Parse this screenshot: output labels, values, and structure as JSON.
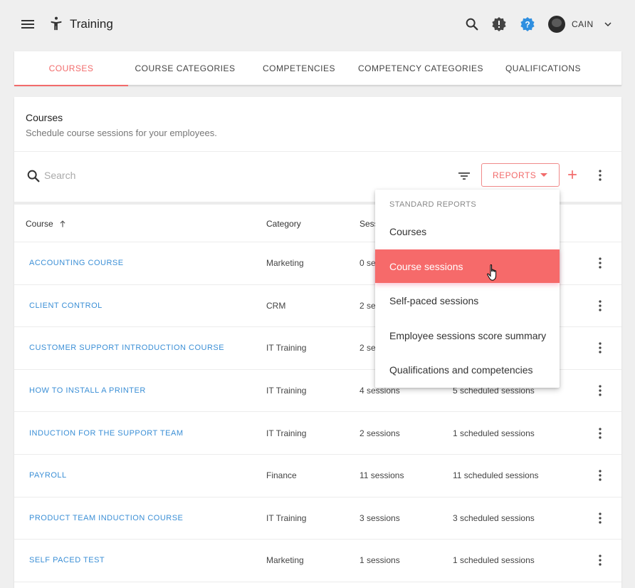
{
  "header": {
    "title": "Training",
    "user_name": "CAIN",
    "icons": [
      "menu-icon",
      "accessibility-icon",
      "search-icon",
      "alert-icon",
      "help-icon",
      "avatar",
      "chevron-down-icon"
    ]
  },
  "tabs": [
    {
      "label": "COURSES",
      "active": true
    },
    {
      "label": "COURSE CATEGORIES",
      "active": false
    },
    {
      "label": "COMPETENCIES",
      "active": false
    },
    {
      "label": "COMPETENCY CATEGORIES",
      "active": false
    },
    {
      "label": "QUALIFICATIONS",
      "active": false
    }
  ],
  "card": {
    "title": "Courses",
    "subtitle": "Schedule course sessions for your employees."
  },
  "toolbar": {
    "search_placeholder": "Search",
    "reports_label": "REPORTS"
  },
  "table": {
    "headers": {
      "course": "Course",
      "category": "Category",
      "sessions": "Sess",
      "scheduled": ""
    },
    "rows": [
      {
        "course": "ACCOUNTING COURSE",
        "category": "Marketing",
        "sessions": "0 se",
        "scheduled": ""
      },
      {
        "course": "CLIENT CONTROL",
        "category": "CRM",
        "sessions": "2 se",
        "scheduled": ""
      },
      {
        "course": "CUSTOMER SUPPORT INTRODUCTION COURSE",
        "category": "IT Training",
        "sessions": "2 se",
        "scheduled": ""
      },
      {
        "course": "HOW TO INSTALL A PRINTER",
        "category": "IT Training",
        "sessions": "4 sessions",
        "scheduled": "5 scheduled sessions"
      },
      {
        "course": "INDUCTION FOR THE SUPPORT TEAM",
        "category": "IT Training",
        "sessions": "2 sessions",
        "scheduled": "1 scheduled sessions"
      },
      {
        "course": "PAYROLL",
        "category": "Finance",
        "sessions": "11 sessions",
        "scheduled": "11 scheduled sessions"
      },
      {
        "course": "PRODUCT TEAM INDUCTION COURSE",
        "category": "IT Training",
        "sessions": "3 sessions",
        "scheduled": "3 scheduled sessions"
      },
      {
        "course": "SELF PACED TEST",
        "category": "Marketing",
        "sessions": "1 sessions",
        "scheduled": "1 scheduled sessions"
      }
    ]
  },
  "reports_menu": {
    "subheader": "STANDARD REPORTS",
    "items": [
      {
        "label": "Courses",
        "highlighted": false
      },
      {
        "label": "Course sessions",
        "highlighted": true
      },
      {
        "label": "Self-paced sessions",
        "highlighted": false
      },
      {
        "label": "Employee sessions score summary",
        "highlighted": false
      },
      {
        "label": "Qualifications and competencies",
        "highlighted": false
      }
    ]
  },
  "colors": {
    "accent": "#f26b6b",
    "link": "#3b8fd6",
    "help": "#2f8fe0",
    "background": "#efefef"
  }
}
